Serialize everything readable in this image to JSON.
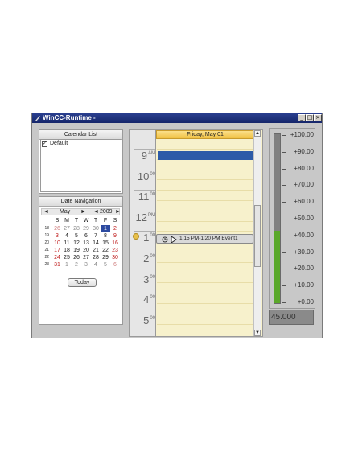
{
  "window": {
    "title": "WinCC-Runtime -",
    "buttons": {
      "minimize": "_",
      "maximize": "□",
      "close": "×"
    }
  },
  "calendar_list": {
    "header": "Calendar List",
    "items": [
      {
        "label": "Default",
        "checked": true
      }
    ]
  },
  "date_navigation": {
    "header": "Date Navigation",
    "month": "May",
    "year": "2009",
    "prev_month": "◄",
    "next_month": "►",
    "prev_year": "◄",
    "next_year": "►",
    "weekday_headers": [
      "S",
      "M",
      "T",
      "W",
      "T",
      "F",
      "S"
    ],
    "week_numbers": [
      "18",
      "19",
      "20",
      "21",
      "22",
      "23"
    ],
    "weeks": [
      [
        "26",
        "27",
        "28",
        "29",
        "30",
        "1",
        "2"
      ],
      [
        "3",
        "4",
        "5",
        "6",
        "7",
        "8",
        "9"
      ],
      [
        "10",
        "11",
        "12",
        "13",
        "14",
        "15",
        "16"
      ],
      [
        "17",
        "18",
        "19",
        "20",
        "21",
        "22",
        "23"
      ],
      [
        "24",
        "25",
        "26",
        "27",
        "28",
        "29",
        "30"
      ],
      [
        "31",
        "1",
        "2",
        "3",
        "4",
        "5",
        "6"
      ]
    ],
    "selected_day": "1",
    "today_button": "Today"
  },
  "day_view": {
    "header": "Friday, May 01",
    "hours": [
      {
        "h": "9",
        "suffix": "AM"
      },
      {
        "h": "10",
        "suffix": "00"
      },
      {
        "h": "11",
        "suffix": "00"
      },
      {
        "h": "12",
        "suffix": "PM"
      },
      {
        "h": "1",
        "suffix": "00"
      },
      {
        "h": "2",
        "suffix": "00"
      },
      {
        "h": "3",
        "suffix": "00"
      },
      {
        "h": "4",
        "suffix": "00"
      },
      {
        "h": "5",
        "suffix": "00"
      }
    ],
    "event": {
      "text": "1:15 PM-1:20 PM Event1"
    }
  },
  "meter": {
    "scale": [
      "+100.00",
      "+90.00",
      "+80.00",
      "+70.00",
      "+60.00",
      "+50.00",
      "+40.00",
      "+30.00",
      "+20.00",
      "+10.00",
      "+0.00"
    ],
    "value_percent": 43,
    "readout": "45.000",
    "colors": {
      "fill": "#5aa82a",
      "track": "#808080"
    }
  }
}
